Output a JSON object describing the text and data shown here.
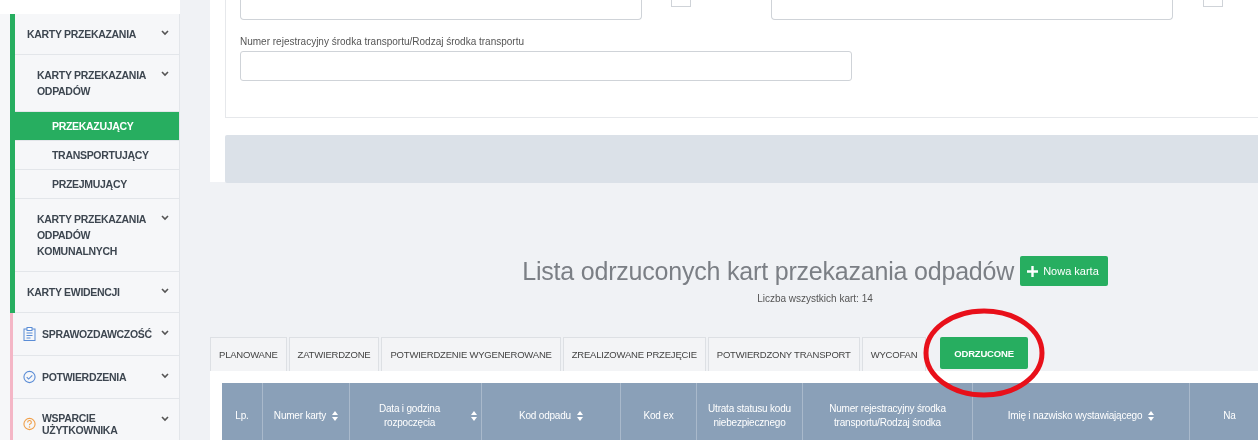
{
  "sidebar": {
    "group": [
      {
        "label": "KARTY PRZEKAZANIA",
        "children": [
          {
            "label": "KARTY PRZEKAZANIA ODPADÓW",
            "children": [
              {
                "label": "PRZEKAZUJĄCY",
                "selected": true
              },
              {
                "label": "TRANSPORTUJĄCY",
                "selected": false
              },
              {
                "label": "PRZEJMUJĄCY",
                "selected": false
              }
            ]
          },
          {
            "label": "KARTY PRZEKAZANIA ODPADÓW KOMUNALNYCH"
          }
        ]
      },
      {
        "label": "KARTY EWIDENCJI"
      }
    ],
    "sections": [
      {
        "label": "SPRAWOZDAWCZOŚĆ"
      },
      {
        "label": "POTWIERDZENIA"
      },
      {
        "label": "WSPARCIE UŻYTKOWNIKA"
      }
    ]
  },
  "filter_form": {
    "checkboxes": [
      {
        "checked": false
      },
      {
        "checked": false
      }
    ],
    "field_label": "Numer rejestracyjny środka transportu/Rodzaj środka transportu"
  },
  "list": {
    "title": "Lista odrzuconych kart przekazania odpadów",
    "new_button": "Nowa karta",
    "count": "Liczba wszystkich kart: 14"
  },
  "tabs": [
    {
      "label": "PLANOWANE",
      "selected": false
    },
    {
      "label": "ZATWIERDZONE",
      "selected": false
    },
    {
      "label": "POTWIERDZENIE WYGENEROWANE",
      "selected": false
    },
    {
      "label": "ZREALIZOWANE PRZEJĘCIE",
      "selected": false
    },
    {
      "label": "POTWIERDZONY TRANSPORT",
      "selected": false
    },
    {
      "label": "WYCOFAN",
      "selected": false
    },
    {
      "label": "ODRZUCONE",
      "selected": true
    }
  ],
  "table": {
    "columns": [
      {
        "label": "Lp.",
        "sortable": false
      },
      {
        "label": "Numer karty",
        "sortable": true
      },
      {
        "label": "Data i godzina rozpoczęcia",
        "sortable": true
      },
      {
        "label": "Kod odpadu",
        "sortable": true
      },
      {
        "label": "Kod ex",
        "sortable": false
      },
      {
        "label": "Utrata statusu kodu niebezpiecznego",
        "sortable": false
      },
      {
        "label": "Numer rejestracyjny środka transportu/Rodzaj środka",
        "sortable": false
      },
      {
        "label": "Imię i nazwisko wystawiającego",
        "sortable": true
      },
      {
        "label": "Na",
        "sortable": false
      }
    ]
  }
}
